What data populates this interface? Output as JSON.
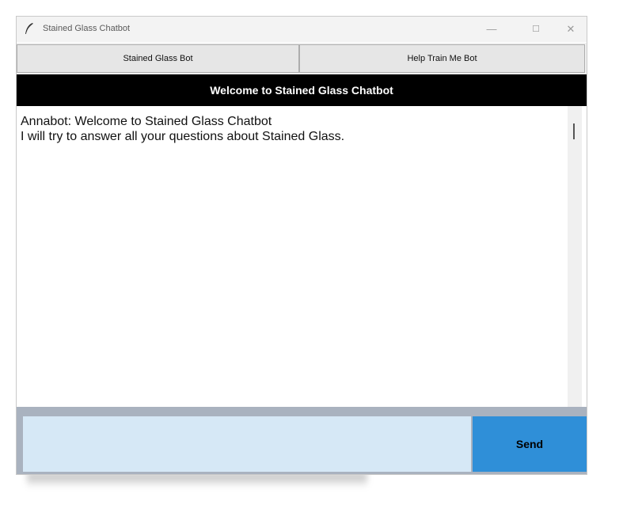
{
  "window": {
    "title": "Stained Glass Chatbot",
    "minimize": "—",
    "maximize": "☐",
    "close": "✕"
  },
  "tabs": [
    {
      "label": "Stained Glass Bot"
    },
    {
      "label": "Help Train Me Bot"
    }
  ],
  "header": {
    "title": "Welcome to Stained Glass Chatbot"
  },
  "chat": {
    "lines": [
      "Annabot: Welcome to Stained Glass Chatbot",
      "I will try to answer all your questions about Stained Glass."
    ]
  },
  "input": {
    "value": "",
    "placeholder": ""
  },
  "send": {
    "label": "Send"
  },
  "colors": {
    "header_bg": "#000000",
    "input_bg": "#d6e8f6",
    "send_bg": "#2f8fd8",
    "footer_bg": "#a9b2bf"
  },
  "icons": {
    "app": "feather-icon"
  }
}
